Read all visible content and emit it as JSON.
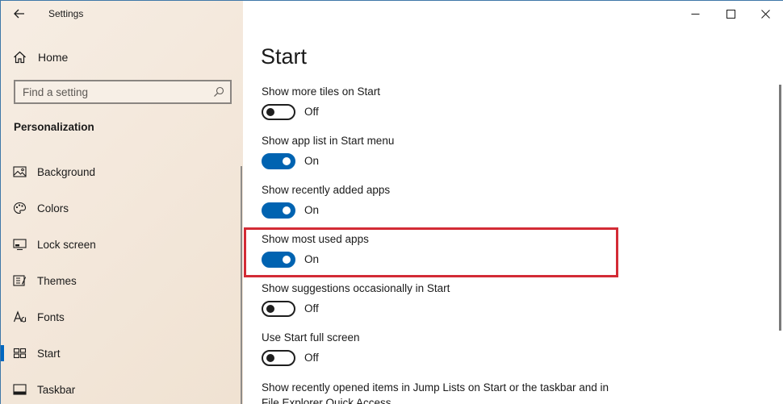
{
  "window": {
    "title": "Settings"
  },
  "sidebar": {
    "home_label": "Home",
    "search_placeholder": "Find a setting",
    "section_title": "Personalization",
    "items": [
      {
        "label": "Background",
        "icon": "image-icon",
        "selected": false
      },
      {
        "label": "Colors",
        "icon": "palette-icon",
        "selected": false
      },
      {
        "label": "Lock screen",
        "icon": "lock-screen-icon",
        "selected": false
      },
      {
        "label": "Themes",
        "icon": "themes-icon",
        "selected": false
      },
      {
        "label": "Fonts",
        "icon": "fonts-icon",
        "selected": false
      },
      {
        "label": "Start",
        "icon": "start-icon",
        "selected": true
      },
      {
        "label": "Taskbar",
        "icon": "taskbar-icon",
        "selected": false
      }
    ]
  },
  "main": {
    "title": "Start",
    "settings": [
      {
        "label": "Show more tiles on Start",
        "state": "Off"
      },
      {
        "label": "Show app list in Start menu",
        "state": "On"
      },
      {
        "label": "Show recently added apps",
        "state": "On"
      },
      {
        "label": "Show most used apps",
        "state": "On"
      },
      {
        "label": "Show suggestions occasionally in Start",
        "state": "Off"
      },
      {
        "label": "Use Start full screen",
        "state": "Off"
      },
      {
        "label_line1": "Show recently opened items in Jump Lists on Start or the taskbar and in",
        "label_line2": "File Explorer Quick Access"
      }
    ]
  },
  "colors": {
    "accent": "#0063b1",
    "highlight": "#d32b35"
  }
}
